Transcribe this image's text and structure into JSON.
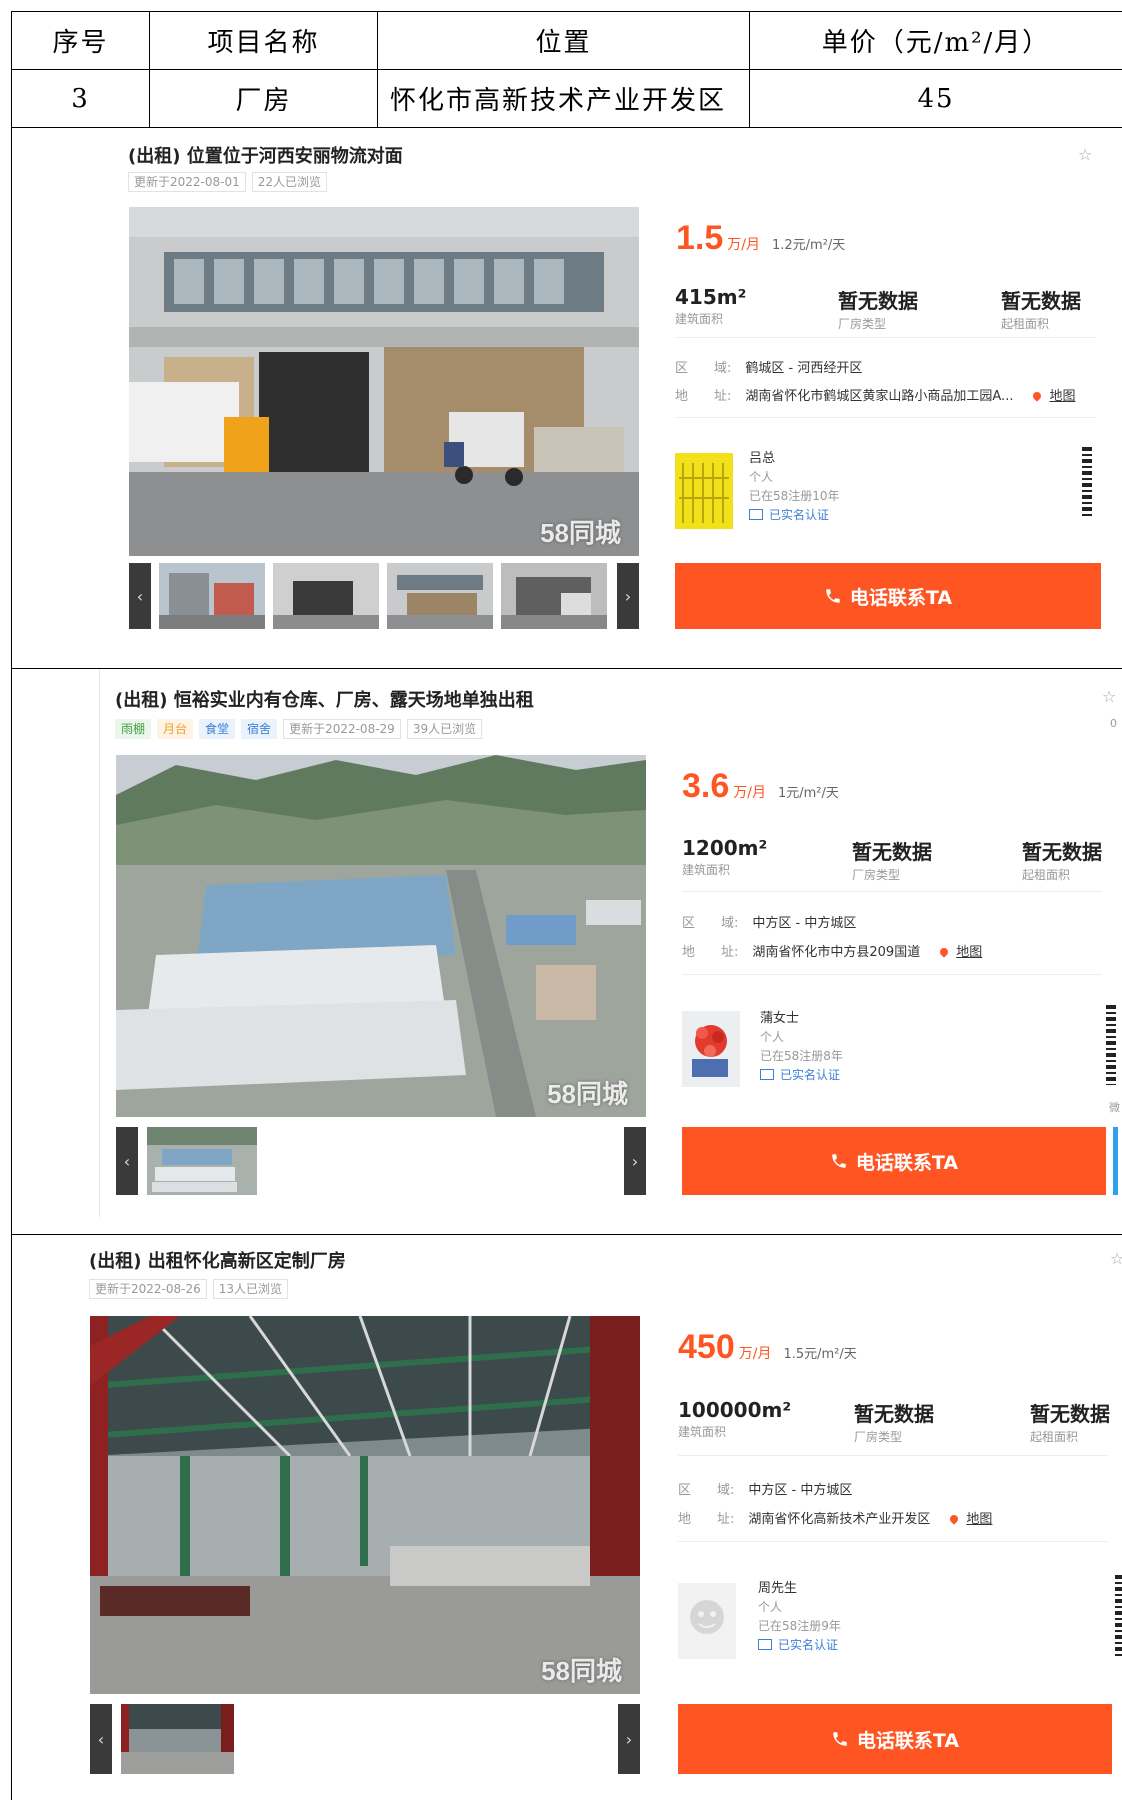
{
  "table": {
    "headers": [
      "序号",
      "项目名称",
      "位置",
      "单价（元/m²/月）"
    ],
    "row": [
      "3",
      "厂房",
      "怀化市高新技术产业开发区",
      "45"
    ]
  },
  "listings": [
    {
      "title": "(出租) 位置位于河西安丽物流对面",
      "tags": [],
      "updated": "更新于2022-08-01",
      "views": "22人已浏览",
      "price": "1.5",
      "price_unit": "万/月",
      "price_per": "1.2元/m²/天",
      "area": "415m²",
      "area_label": "建筑面积",
      "type_val": "暂无数据",
      "type_label": "厂房类型",
      "min_val": "暂无数据",
      "min_label": "起租面积",
      "district_key": "区　　域:",
      "district": "鹤城区 - 河西经开区",
      "address_key": "地　　址:",
      "address": "湖南省怀化市鹤城区黄家山路小商品加工园A...",
      "map": "地图",
      "agent_name": "吕总",
      "agent_role": "个人",
      "agent_reg": "已在58注册10年",
      "agent_verified": "已实名认证",
      "call": "电话联系TA",
      "watermark": "58同城"
    },
    {
      "title": "(出租) 恒裕实业内有仓库、厂房、露天场地单独出租",
      "tags": [
        "雨棚",
        "月台",
        "食堂",
        "宿舍"
      ],
      "updated": "更新于2022-08-29",
      "views": "39人已浏览",
      "price": "3.6",
      "price_unit": "万/月",
      "price_per": "1元/m²/天",
      "area": "1200m²",
      "area_label": "建筑面积",
      "type_val": "暂无数据",
      "type_label": "厂房类型",
      "min_val": "暂无数据",
      "min_label": "起租面积",
      "district_key": "区　　域:",
      "district": "中方区 - 中方城区",
      "address_key": "地　　址:",
      "address": "湖南省怀化市中方县209国道",
      "map": "地图",
      "agent_name": "蒲女士",
      "agent_role": "个人",
      "agent_reg": "已在58注册8年",
      "agent_verified": "已实名认证",
      "call": "电话联系TA",
      "watermark": "58同城",
      "star_count": "0",
      "side_char": "微"
    },
    {
      "title": "(出租) 出租怀化高新区定制厂房",
      "tags": [],
      "updated": "更新于2022-08-26",
      "views": "13人已浏览",
      "price": "450",
      "price_unit": "万/月",
      "price_per": "1.5元/m²/天",
      "area": "100000m²",
      "area_label": "建筑面积",
      "type_val": "暂无数据",
      "type_label": "厂房类型",
      "min_val": "暂无数据",
      "min_label": "起租面积",
      "district_key": "区　　域:",
      "district": "中方区 - 中方城区",
      "address_key": "地　　址:",
      "address": "湖南省怀化高新技术产业开发区",
      "map": "地图",
      "agent_name": "周先生",
      "agent_role": "个人",
      "agent_reg": "已在58注册9年",
      "agent_verified": "已实名认证",
      "call": "电话联系TA",
      "watermark": "58同城"
    }
  ],
  "icons": {
    "phone": "phone-icon",
    "star": "star-icon",
    "map_pin": "map-pin-icon",
    "prev": "chevron-left-icon",
    "next": "chevron-right-icon"
  },
  "colors": {
    "accent": "#ff5522",
    "verified": "#3b7fd6"
  }
}
